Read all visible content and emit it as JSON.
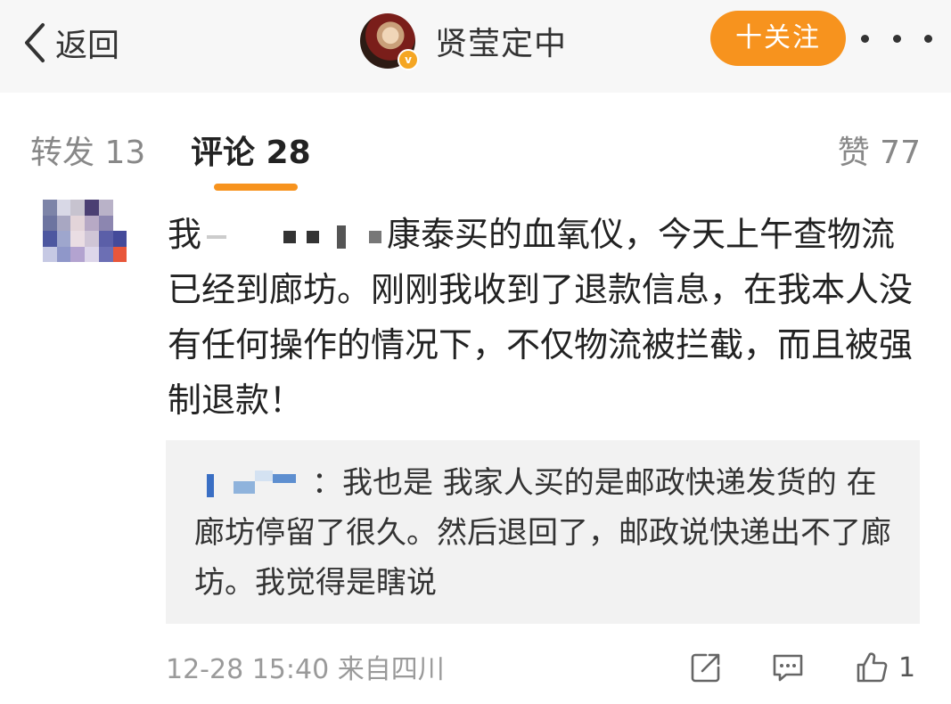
{
  "nav": {
    "back_label": "返回",
    "username": "贤莹定中",
    "verified_badge": "v",
    "follow_label": "十关注",
    "accent": "#f7931e"
  },
  "tabs": {
    "repost": "转发 13",
    "comments": "评论 28",
    "likes": "赞 77"
  },
  "comment": {
    "text_start": "我",
    "text_rest": "康泰买的血氧仪，今天上午查物流已经到廊坊。刚刚我收到了退款信息，在我本人没有任何操作的情况下，不仅物流被拦截，而且被强制退款！",
    "reply": {
      "name_suffix": "：",
      "text": "我也是 我家人买的是邮政快递发货的 在廊坊停留了很久。然后退回了，邮政说快递出不了廊坊。我觉得是瞎说"
    },
    "timestamp": "12-28 15:40",
    "source": "来自四川",
    "like_count": "1"
  },
  "icons": [
    "chevron-left-icon",
    "verified-icon",
    "more-icon",
    "share-icon",
    "comment-icon",
    "like-icon"
  ]
}
